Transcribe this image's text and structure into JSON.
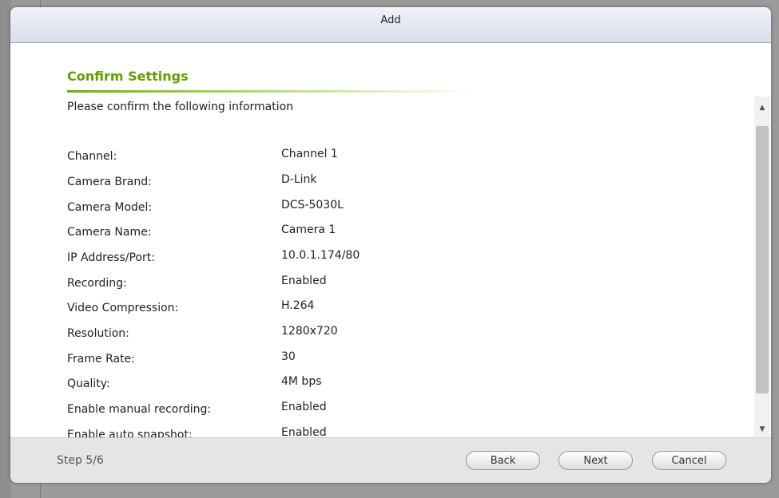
{
  "dialog": {
    "title": "Add"
  },
  "section": {
    "heading": "Confirm Settings",
    "instruction": "Please confirm the following information"
  },
  "settings": [
    {
      "label": "Channel:",
      "value": "Channel 1"
    },
    {
      "label": "Camera Brand:",
      "value": "D-Link"
    },
    {
      "label": "Camera Model:",
      "value": "DCS-5030L"
    },
    {
      "label": "Camera Name:",
      "value": "Camera 1"
    },
    {
      "label": "IP Address/Port:",
      "value": "10.0.1.174/80"
    },
    {
      "label": "Recording:",
      "value": "Enabled"
    },
    {
      "label": "Video Compression:",
      "value": "H.264"
    },
    {
      "label": "Resolution:",
      "value": "1280x720"
    },
    {
      "label": "Frame Rate:",
      "value": "30"
    },
    {
      "label": "Quality:",
      "value": "4M bps"
    },
    {
      "label": "Enable manual recording:",
      "value": "Enabled"
    },
    {
      "label": "Enable auto snapshot:",
      "value": "Enabled"
    }
  ],
  "scrollbar": {
    "up_icon": "▲",
    "down_icon": "▼"
  },
  "footer": {
    "step": "Step 5/6",
    "back_label": "Back",
    "next_label": "Next",
    "cancel_label": "Cancel"
  }
}
